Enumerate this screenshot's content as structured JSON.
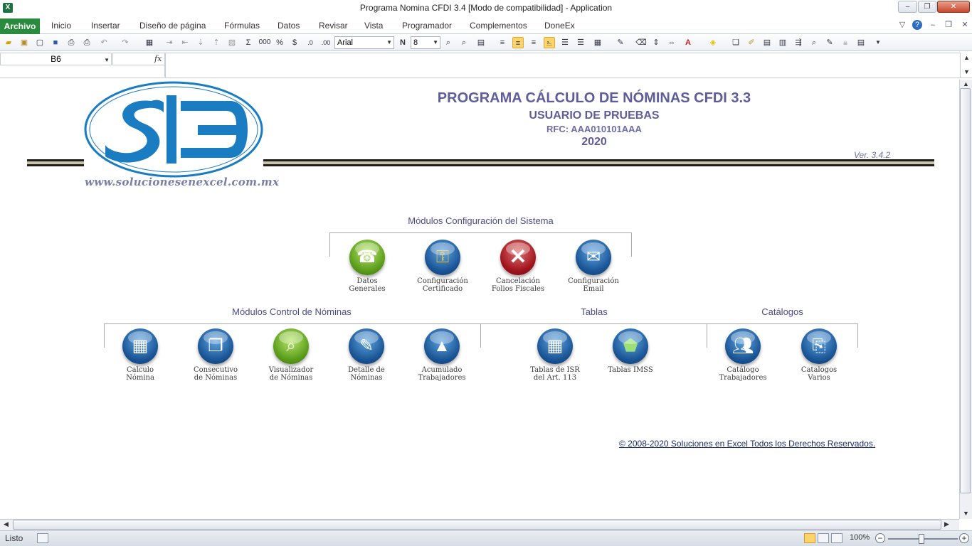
{
  "window": {
    "title": "Programa Nomina CFDI 3.4  [Modo de compatibilidad]  -  Application",
    "app_icon": "excel-icon",
    "controls": {
      "minimize": "–",
      "maximize": "❐",
      "close": "✕"
    }
  },
  "ribbon": {
    "tabs": [
      "Archivo",
      "Inicio",
      "Insertar",
      "Diseño de página",
      "Fórmulas",
      "Datos",
      "Revisar",
      "Vista",
      "Programador",
      "Complementos",
      "DoneEx"
    ],
    "right_icons": [
      "collapse-ribbon-icon",
      "help-icon",
      "minimize-icon",
      "restore-icon",
      "close-icon"
    ]
  },
  "toolbar": {
    "font": "Arial",
    "size": "8",
    "bold_label": "N",
    "sum_label": "Σ",
    "thousands_label": "000",
    "percent_label": "%",
    "currency_label": "$"
  },
  "formula_bar": {
    "cell_ref": "B6",
    "fx_label": "fx",
    "value": ""
  },
  "sheet": {
    "logo_url": "www.solucionesenexcel.com.mx",
    "logo_letters": "SE",
    "title": "PROGRAMA CÁLCULO DE NÓMINAS CFDI 3.3",
    "user": "USUARIO DE PRUEBAS",
    "rfc": "RFC: AAA010101AAA",
    "year": "2020",
    "version": "Ver. 3.4.2",
    "sections": {
      "config": "Módulos Configuración del Sistema",
      "control": "Módulos Control de Nóminas",
      "tablas": "Tablas",
      "catalogos": "Catálogos"
    },
    "config_modules": [
      {
        "label": "Datos\nGenerales",
        "icon": "phone-icon",
        "color": "green"
      },
      {
        "label": "Configuración\nCertificado",
        "icon": "key-icon",
        "color": "blue"
      },
      {
        "label": "Cancelación\nFolios Fiscales",
        "icon": "x-icon",
        "color": "red"
      },
      {
        "label": "Configuración\nEmail",
        "icon": "envelope-icon",
        "color": "blue"
      }
    ],
    "control_modules": [
      {
        "label": "Calculo\nNómina",
        "icon": "calculator-icon",
        "color": "blue"
      },
      {
        "label": "Consecutivo\nde Nóminas",
        "icon": "documents-icon",
        "color": "blue"
      },
      {
        "label": "Visualizador\nde Nóminas",
        "icon": "magnifier-icon",
        "color": "green"
      },
      {
        "label": "Detalle  de\nNóminas",
        "icon": "document-edit-icon",
        "color": "blue"
      },
      {
        "label": "Acumulado\nTrabajadores",
        "icon": "triangle-icon",
        "color": "blue"
      }
    ],
    "tablas_modules": [
      {
        "label": "Tablas de ISR\ndel Art. 113",
        "icon": "grid-icon",
        "color": "blue"
      },
      {
        "label": "Tablas IMSS",
        "icon": "shield-icon",
        "color": "blue"
      }
    ],
    "catalogo_modules": [
      {
        "label": "Catálogo\nTrabajadores",
        "icon": "people-icon",
        "color": "blue"
      },
      {
        "label": "Catalogos\nVarios",
        "icon": "paperclip-icon",
        "color": "blue"
      }
    ],
    "copyright": "© 2008-2020 Soluciones en Excel Todos los Derechos Reservados."
  },
  "status": {
    "text": "Listo",
    "zoom": "100%"
  }
}
